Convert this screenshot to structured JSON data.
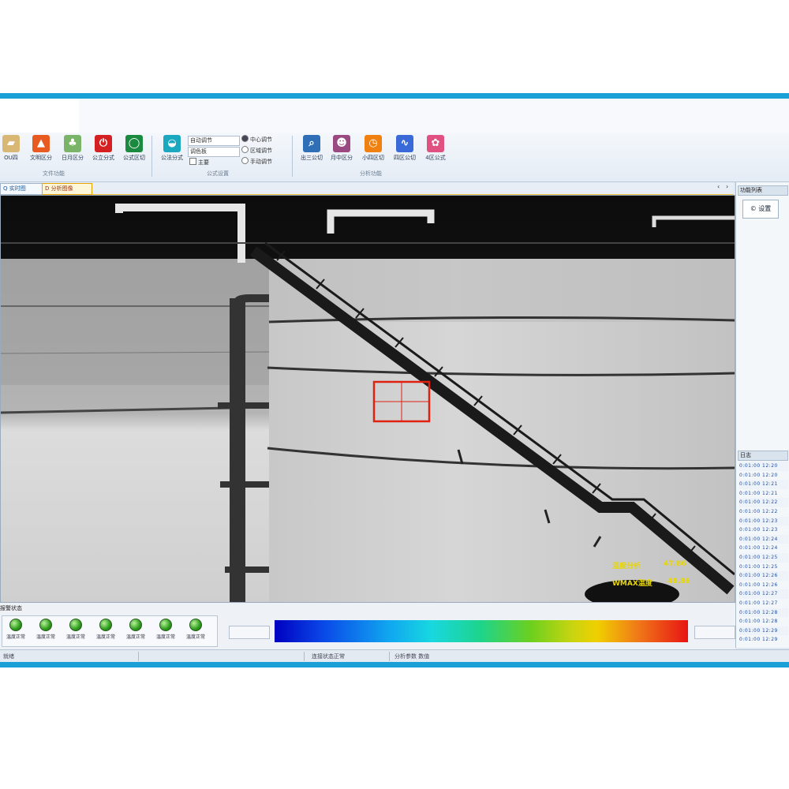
{
  "colors": {
    "accent": "#1aa0d6",
    "highlight_box": "#e02010",
    "overlay_text": "#e8d600",
    "led_on": "#2c9a1c"
  },
  "ribbon": {
    "buttons": [
      {
        "label": "OU四",
        "icon": "folder-icon",
        "color": "#c79a50"
      },
      {
        "label": "文明区分",
        "icon": "fire-icon",
        "color": "#e04a1a"
      },
      {
        "label": "日月区分",
        "icon": "tree-icon",
        "color": "#5aa050"
      },
      {
        "label": "公立分式",
        "icon": "power-icon",
        "color": "#d42020"
      },
      {
        "label": "公式区切",
        "icon": "record-icon",
        "color": "#1a9a4a"
      },
      {
        "label": "公法分式",
        "icon": "chat-icon",
        "color": "#1aa8c0"
      },
      {
        "label": "出三公切",
        "icon": "search-icon",
        "color": "#2f6fb8"
      },
      {
        "label": "月中区分",
        "icon": "user-icon",
        "color": "#9a4a80"
      },
      {
        "label": "小四区切",
        "icon": "clock-icon",
        "color": "#f08010"
      },
      {
        "label": "四区公切",
        "icon": "wave-icon",
        "color": "#3a6ad8"
      },
      {
        "label": "4区公式",
        "icon": "graph-icon",
        "color": "#e05080"
      }
    ],
    "groups": [
      "文件功能",
      "公式设置",
      "分析功能"
    ],
    "combo1": "自动调节",
    "combo2": "调色板",
    "check1": "主要",
    "radio1": "中心调节",
    "radio2": "区域调节",
    "radio3": "手动调节"
  },
  "tabs": {
    "first": "Q 实时图",
    "second": "D 分析图像"
  },
  "sidebar": {
    "header1": "功能列表",
    "button": "© 设置",
    "header2": "日志",
    "rows": [
      "0:01:00 12:20",
      "0:01:00 12:20",
      "0:01:00 12:21",
      "0:01:00 12:21",
      "0:01:00 12:22",
      "0:01:00 12:22",
      "0:01:00 12:23",
      "0:01:00 12:23",
      "0:01:00 12:24",
      "0:01:00 12:24",
      "0:01:00 12:25",
      "0:01:00 12:25",
      "0:01:00 12:26",
      "0:01:00 12:26",
      "0:01:00 12:27",
      "0:01:00 12:27",
      "0:01:00 12:28",
      "0:01:00 12:28",
      "0:01:00 12:29",
      "0:01:00 12:29"
    ]
  },
  "overlay": {
    "line1_left": "温度分析",
    "line1_right": "47.86",
    "line2_left": "WMAX温度",
    "line2_right": "48.86"
  },
  "bottom": {
    "title": "报警状态",
    "leds": [
      "温度正常",
      "温度正常",
      "温度正常",
      "温度正常",
      "温度正常",
      "温度正常",
      "温度正常"
    ],
    "box_left": "",
    "box_right": ""
  },
  "status": {
    "left": "就绪",
    "mid": "连接状态正常",
    "right": "分析参数 数值"
  }
}
